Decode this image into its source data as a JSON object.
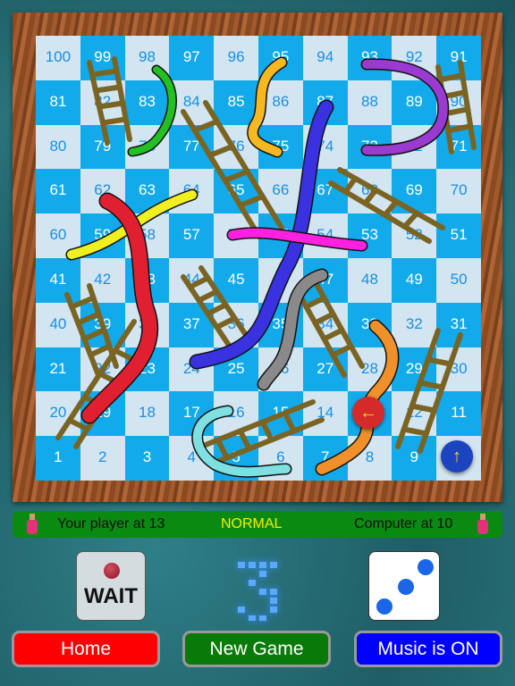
{
  "board": {
    "rows": [
      [
        100,
        99,
        98,
        97,
        96,
        95,
        94,
        93,
        92,
        91
      ],
      [
        81,
        82,
        83,
        84,
        85,
        86,
        87,
        88,
        89,
        90
      ],
      [
        80,
        79,
        78,
        77,
        76,
        75,
        74,
        73,
        72,
        71
      ],
      [
        61,
        62,
        63,
        64,
        65,
        66,
        67,
        68,
        69,
        70
      ],
      [
        60,
        59,
        58,
        57,
        56,
        55,
        54,
        53,
        52,
        51
      ],
      [
        41,
        42,
        43,
        44,
        45,
        46,
        47,
        48,
        49,
        50
      ],
      [
        40,
        39,
        38,
        37,
        36,
        35,
        34,
        33,
        32,
        31
      ],
      [
        21,
        22,
        23,
        24,
        25,
        26,
        27,
        28,
        29,
        30
      ],
      [
        20,
        19,
        18,
        17,
        16,
        15,
        14,
        13,
        12,
        11
      ],
      [
        1,
        2,
        3,
        4,
        5,
        6,
        7,
        8,
        9,
        10
      ]
    ],
    "colors": {
      "light": "#d2e5f1",
      "dark": "#12aaea"
    },
    "player_piece": {
      "square": 13,
      "color": "#d42a2a",
      "icon": "arrow-left-icon",
      "glyph": "←"
    },
    "computer_piece": {
      "square": 10,
      "color": "#1a44c0",
      "icon": "arrow-up-icon",
      "glyph": "↑"
    }
  },
  "status": {
    "player": "Your player at 13",
    "mode": "NORMAL",
    "computer": "Computer at 10"
  },
  "controls": {
    "wait_label": "WAIT",
    "last_roll": 3,
    "die_value": 3
  },
  "buttons": {
    "home": {
      "label": "Home",
      "color": "#ff0000"
    },
    "new_game": {
      "label": "New Game",
      "color": "#087a08"
    },
    "music": {
      "label": "Music is ON",
      "color": "#0000ff"
    }
  }
}
